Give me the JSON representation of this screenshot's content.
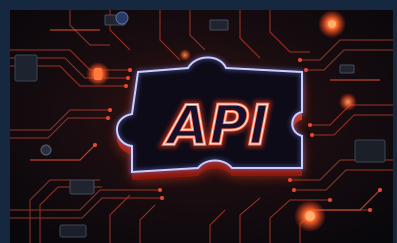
{
  "image": {
    "frame_color": "#15283f",
    "board_color": "#0f0c12",
    "trace_color": "#b23a2c",
    "glow_color": "#ff3b2f",
    "puzzle_fill": "#0d0b18",
    "puzzle_outline": "#e8e6ff",
    "text_glow": "#ff5a3c",
    "accent_blue": "#3f6cff"
  },
  "puzzle": {
    "label": "API"
  }
}
